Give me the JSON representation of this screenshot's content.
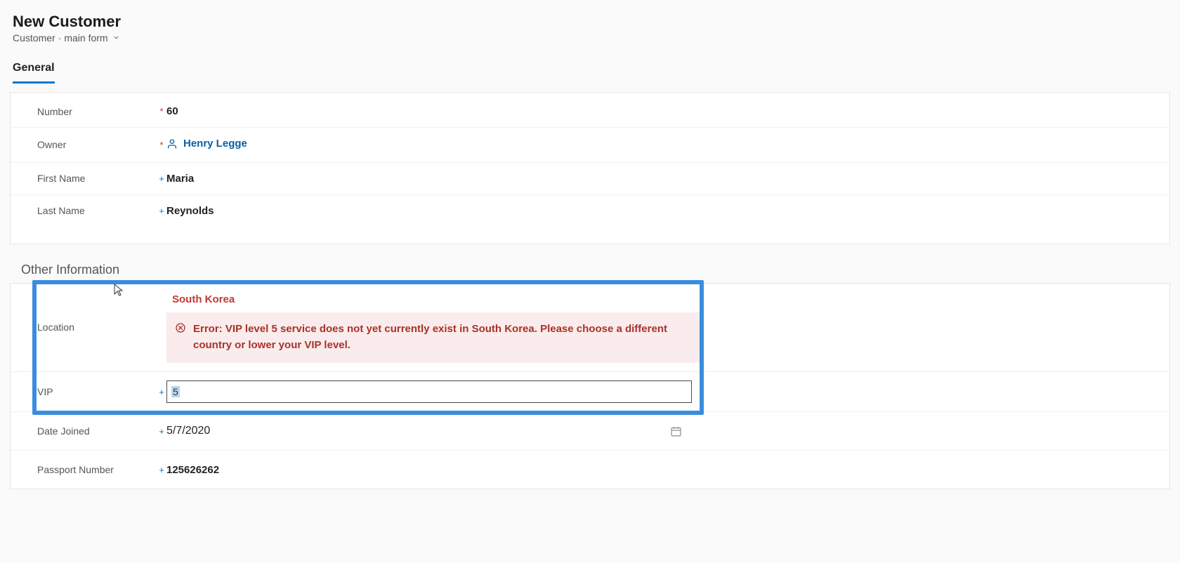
{
  "header": {
    "title": "New Customer",
    "entity": "Customer",
    "form_selector_label": "main form"
  },
  "tabs": {
    "general": "General"
  },
  "general_fields": {
    "number": {
      "label": "Number",
      "value": "60",
      "marker": "*"
    },
    "owner": {
      "label": "Owner",
      "value": "Henry Legge",
      "marker": "*"
    },
    "first_name": {
      "label": "First Name",
      "value": "Maria",
      "marker": "+"
    },
    "last_name": {
      "label": "Last Name",
      "value": "Reynolds",
      "marker": "+"
    }
  },
  "other_section": {
    "title": "Other Information",
    "location": {
      "label": "Location",
      "value": "South Korea",
      "error": "Error: VIP level 5 service does not yet currently exist in South Korea. Please choose a different country or lower your VIP level."
    },
    "vip": {
      "label": "VIP",
      "value": "5",
      "marker": "+"
    },
    "date_joined": {
      "label": "Date Joined",
      "value": "5/7/2020",
      "marker": "+"
    },
    "passport": {
      "label": "Passport Number",
      "value": "125626262",
      "marker": "+"
    }
  }
}
